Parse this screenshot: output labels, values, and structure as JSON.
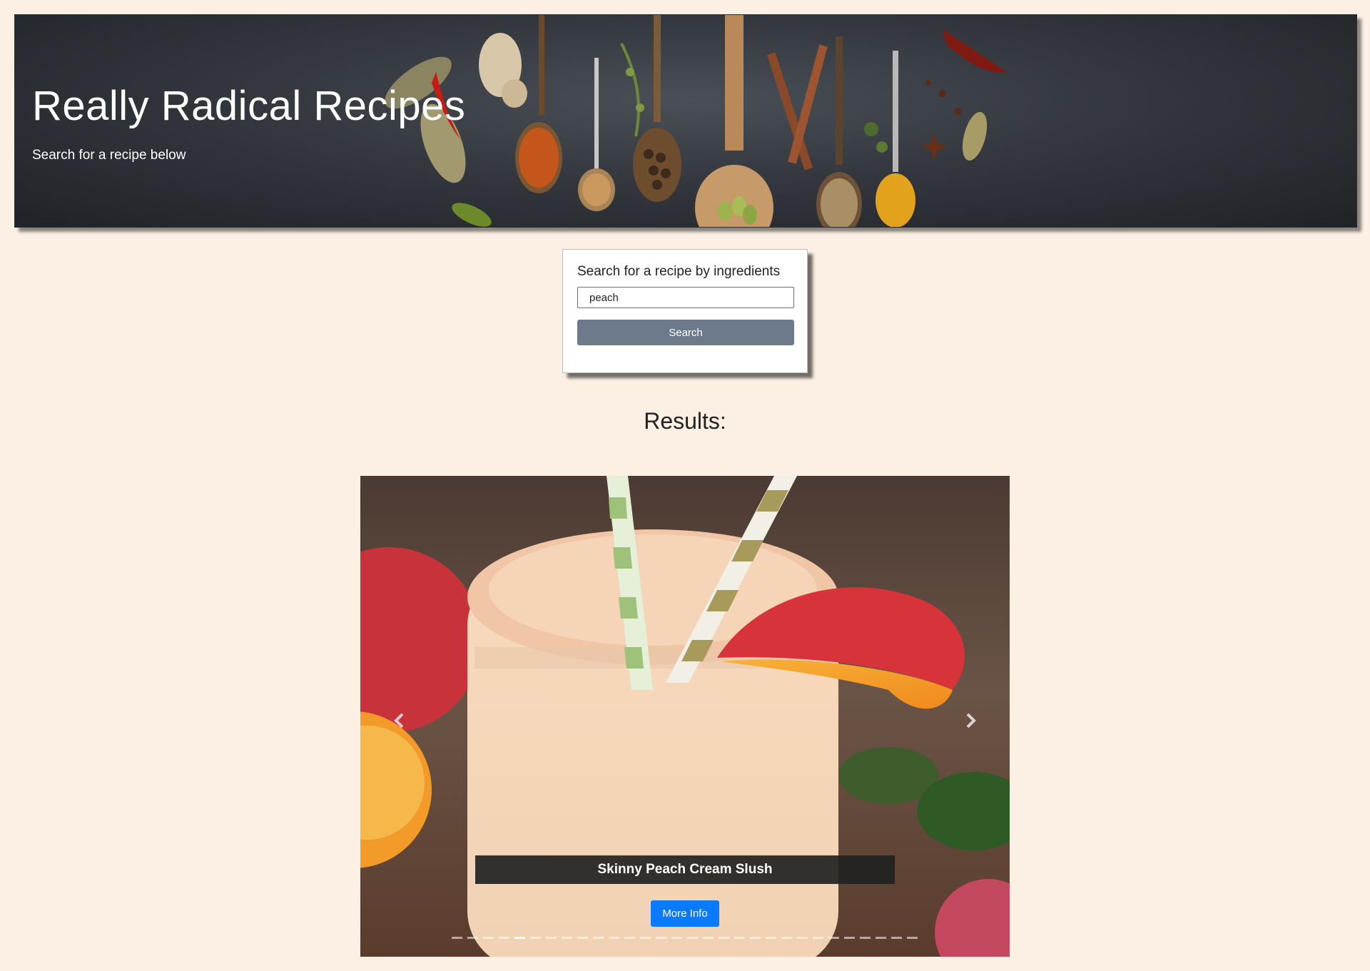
{
  "header": {
    "title": "Really Radical Recipes",
    "subtitle": "Search for a recipe below"
  },
  "search": {
    "label": "Search for a recipe by ingredients",
    "value": "peach",
    "button_label": "Search"
  },
  "results": {
    "heading": "Results:",
    "carousel": {
      "current_index": 4,
      "total_slides": 30,
      "slide": {
        "title": "Skinny Peach Cream Slush",
        "button_label": "More Info"
      },
      "prev_icon": "chevron-left-icon",
      "next_icon": "chevron-right-icon"
    }
  },
  "colors": {
    "page_background": "#fcf0e4",
    "search_button": "#6c7a8c",
    "more_info_button": "#0a7bff",
    "caption_background": "#222222"
  }
}
